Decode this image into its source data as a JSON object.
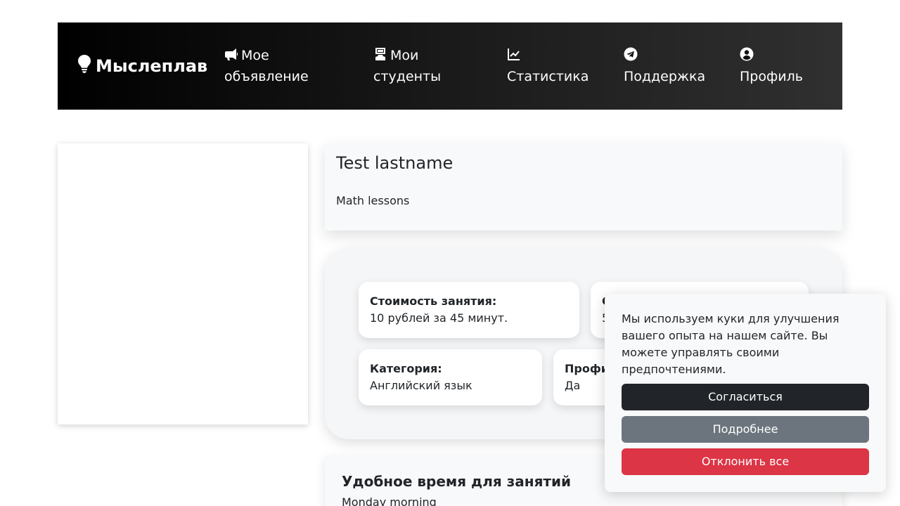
{
  "navbar": {
    "brand": "Мыслеплав",
    "items": [
      {
        "label": "Мое объявление",
        "icon": "megaphone-icon"
      },
      {
        "label": "Мои студенты",
        "icon": "teacher-icon"
      },
      {
        "label": "Статистика",
        "icon": "chart-line-icon"
      },
      {
        "label": "Поддержка",
        "icon": "telegram-icon"
      },
      {
        "label": "Профиль",
        "icon": "user-circle-icon"
      }
    ]
  },
  "listing": {
    "name": "Test lastname",
    "description": "Math lessons"
  },
  "info": {
    "price": {
      "label": "Стоимость занятия:",
      "value": "10 рублей за 45 минут."
    },
    "second": {
      "label": "С",
      "value": "5"
    },
    "category": {
      "label": "Категория:",
      "value": "Английский язык"
    },
    "profile": {
      "label": "Профи",
      "value": "Да"
    }
  },
  "schedule": {
    "heading": "Удобное время для занятий",
    "value": "Monday morning"
  },
  "cookie": {
    "message": "Мы используем куки для улучшения вашего опыта на нашем сайте. Вы можете управлять своими предпочтениями.",
    "accept": "Согласиться",
    "more": "Подробнее",
    "decline": "Отклонить все"
  },
  "colors": {
    "accept": "#212529",
    "more": "#6c757d",
    "decline": "#dc3545"
  }
}
